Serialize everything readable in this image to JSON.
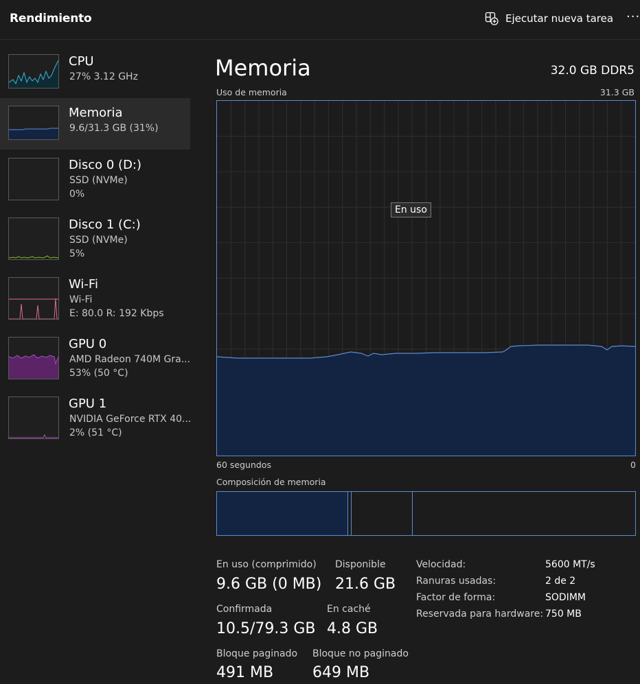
{
  "header": {
    "title": "Rendimiento",
    "run_task_label": "Ejecutar nueva tarea",
    "more_label": "···"
  },
  "sidebar": {
    "items": [
      {
        "title": "CPU",
        "line1": "27%  3.12 GHz",
        "line2": ""
      },
      {
        "title": "Memoria",
        "line1": "9.6/31.3 GB (31%)",
        "line2": ""
      },
      {
        "title": "Disco 0 (D:)",
        "line1": "SSD (NVMe)",
        "line2": "0%"
      },
      {
        "title": "Disco 1 (C:)",
        "line1": "SSD (NVMe)",
        "line2": "5%"
      },
      {
        "title": "Wi-Fi",
        "line1": "Wi-Fi",
        "line2": "E: 80.0  R: 192 Kbps"
      },
      {
        "title": "GPU 0",
        "line1": "AMD Radeon 740M Gra...",
        "line2": "53%  (50 °C)"
      },
      {
        "title": "GPU 1",
        "line1": "NVIDIA GeForce RTX 40...",
        "line2": "2%  (51 °C)"
      }
    ]
  },
  "main": {
    "title": "Memoria",
    "spec": "32.0 GB DDR5",
    "graph_label": "Uso de memoria",
    "graph_max": "31.3 GB",
    "tooltip": "En uso",
    "axis_left": "60 segundos",
    "axis_right": "0",
    "composition_label": "Composición de memoria",
    "stats": {
      "in_use_label": "En uso (comprimido)",
      "in_use_value": "9.6 GB (0 MB)",
      "available_label": "Disponible",
      "available_value": "21.6 GB",
      "committed_label": "Confirmada",
      "committed_value": "10.5/79.3 GB",
      "cached_label": "En caché",
      "cached_value": "4.8 GB",
      "paged_label": "Bloque paginado",
      "paged_value": "491 MB",
      "nonpaged_label": "Bloque no paginado",
      "nonpaged_value": "649 MB"
    },
    "details": [
      {
        "label": "Velocidad:",
        "value": "5600 MT/s"
      },
      {
        "label": "Ranuras usadas:",
        "value": "2 de 2"
      },
      {
        "label": "Factor de forma:",
        "value": "SODIMM"
      },
      {
        "label": "Reservada para hardware:",
        "value": "750 MB"
      }
    ]
  },
  "colors": {
    "background": "#1c1c1c",
    "memory_accent": "#5b8dd0",
    "memory_fill": "#132342",
    "cpu_accent": "#3fb5d6",
    "disk_accent": "#7fc31f",
    "wifi_accent": "#e06a9a",
    "gpu_accent": "#b24bc0"
  }
}
